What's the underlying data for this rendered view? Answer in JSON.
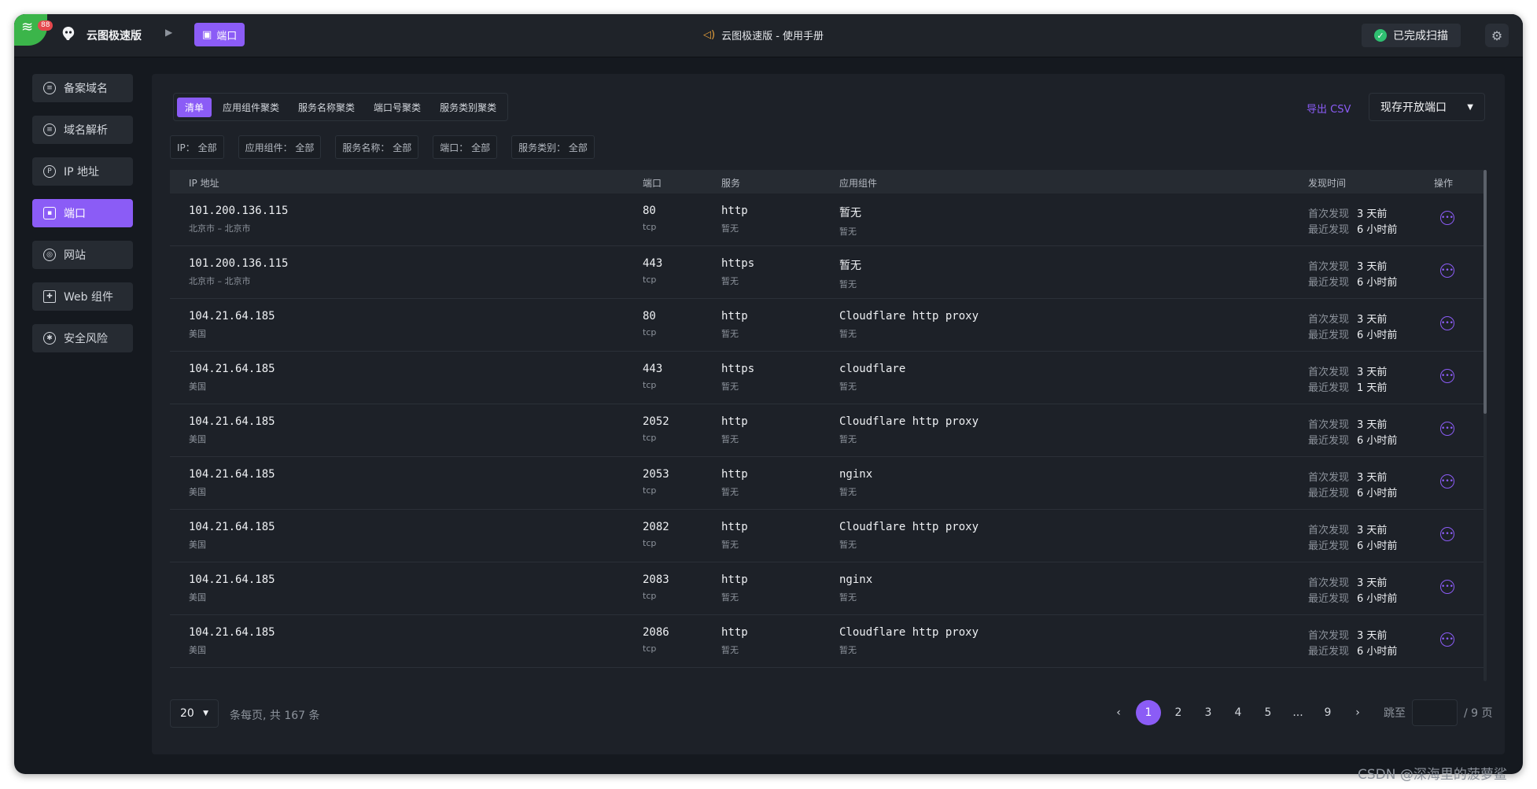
{
  "topbar": {
    "notification_count": "88",
    "app_name": "云图极速版",
    "breadcrumb_active": "端口",
    "manual_link": "云图极速版 - 使用手册",
    "scan_status": "已完成扫描"
  },
  "sidebar": {
    "items": [
      {
        "label": "备案域名",
        "icon": "record-icon"
      },
      {
        "label": "域名解析",
        "icon": "dns-icon"
      },
      {
        "label": "IP 地址",
        "icon": "ip-icon"
      },
      {
        "label": "端口",
        "icon": "port-icon",
        "active": true
      },
      {
        "label": "网站",
        "icon": "website-icon"
      },
      {
        "label": "Web 组件",
        "icon": "puzzle-icon"
      },
      {
        "label": "安全风险",
        "icon": "bug-icon"
      }
    ]
  },
  "toolbar": {
    "tabs": [
      "清单",
      "应用组件聚类",
      "服务名称聚类",
      "端口号聚类",
      "服务类别聚类"
    ],
    "export_label": "导出 CSV",
    "select_value": "现存开放端口"
  },
  "filters": [
    "IP： 全部",
    "应用组件： 全部",
    "服务名称： 全部",
    "端口： 全部",
    "服务类别： 全部"
  ],
  "table": {
    "headers": {
      "ip": "IP 地址",
      "port": "端口",
      "service": "服务",
      "app": "应用组件",
      "time": "发现时间",
      "op": "操作"
    },
    "first_label": "首次发现",
    "last_label": "最近发现",
    "rows": [
      {
        "ip": "101.200.136.115",
        "loc": "北京市 – 北京市",
        "port": "80",
        "proto": "tcp",
        "service": "http",
        "service_sub": "暂无",
        "app": "暂无",
        "app_sub": "暂无",
        "first": "3 天前",
        "last": "6 小时前"
      },
      {
        "ip": "101.200.136.115",
        "loc": "北京市 – 北京市",
        "port": "443",
        "proto": "tcp",
        "service": "https",
        "service_sub": "暂无",
        "app": "暂无",
        "app_sub": "暂无",
        "first": "3 天前",
        "last": "6 小时前"
      },
      {
        "ip": "104.21.64.185",
        "loc": "美国",
        "port": "80",
        "proto": "tcp",
        "service": "http",
        "service_sub": "暂无",
        "app": "Cloudflare http proxy",
        "app_sub": "暂无",
        "first": "3 天前",
        "last": "6 小时前"
      },
      {
        "ip": "104.21.64.185",
        "loc": "美国",
        "port": "443",
        "proto": "tcp",
        "service": "https",
        "service_sub": "暂无",
        "app": "cloudflare",
        "app_sub": "暂无",
        "first": "3 天前",
        "last": "1 天前"
      },
      {
        "ip": "104.21.64.185",
        "loc": "美国",
        "port": "2052",
        "proto": "tcp",
        "service": "http",
        "service_sub": "暂无",
        "app": "Cloudflare http proxy",
        "app_sub": "暂无",
        "first": "3 天前",
        "last": "6 小时前"
      },
      {
        "ip": "104.21.64.185",
        "loc": "美国",
        "port": "2053",
        "proto": "tcp",
        "service": "http",
        "service_sub": "暂无",
        "app": "nginx",
        "app_sub": "暂无",
        "first": "3 天前",
        "last": "6 小时前"
      },
      {
        "ip": "104.21.64.185",
        "loc": "美国",
        "port": "2082",
        "proto": "tcp",
        "service": "http",
        "service_sub": "暂无",
        "app": "Cloudflare http proxy",
        "app_sub": "暂无",
        "first": "3 天前",
        "last": "6 小时前"
      },
      {
        "ip": "104.21.64.185",
        "loc": "美国",
        "port": "2083",
        "proto": "tcp",
        "service": "http",
        "service_sub": "暂无",
        "app": "nginx",
        "app_sub": "暂无",
        "first": "3 天前",
        "last": "6 小时前"
      },
      {
        "ip": "104.21.64.185",
        "loc": "美国",
        "port": "2086",
        "proto": "tcp",
        "service": "http",
        "service_sub": "暂无",
        "app": "Cloudflare http proxy",
        "app_sub": "暂无",
        "first": "3 天前",
        "last": "6 小时前"
      }
    ]
  },
  "footer": {
    "page_size": "20",
    "total_text": "条每页, 共 167 条",
    "pages": [
      "1",
      "2",
      "3",
      "4",
      "5",
      "...",
      "9"
    ],
    "current_page": "1",
    "jump_label": "跳至",
    "jump_total": "/ 9 页"
  },
  "watermark": "CSDN @深海里的菠萝鲨",
  "colors": {
    "accent": "#8b5cf6",
    "success": "#2fbf71",
    "bg": "#15191f"
  }
}
